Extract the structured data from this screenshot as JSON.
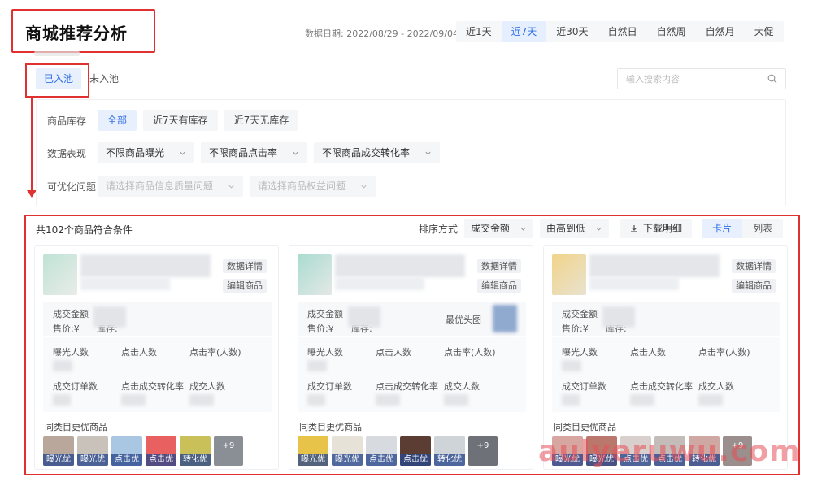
{
  "header": {
    "title": "商城推荐分析",
    "date_label": "数据日期: 2022/08/29 - 2022/09/04",
    "ranges": [
      "近1天",
      "近7天",
      "近30天",
      "自然日",
      "自然周",
      "自然月",
      "大促"
    ],
    "active_range": "近7天"
  },
  "pool_tabs": [
    "已入池",
    "未入池"
  ],
  "search": {
    "placeholder": "输入搜索内容"
  },
  "filters": {
    "stock": {
      "label": "商品库存",
      "options": [
        "全部",
        "近7天有库存",
        "近7天无库存"
      ]
    },
    "performance": {
      "label": "数据表现",
      "dropdowns": [
        "不限商品曝光",
        "不限商品点击率",
        "不限商品成交转化率"
      ]
    },
    "optimizable": {
      "label": "可优化问题",
      "dropdowns": [
        "请选择商品信息质量问题",
        "请选择商品权益问题"
      ]
    }
  },
  "results": {
    "count_text": "共102个商品符合条件",
    "sort_label": "排序方式",
    "sort_field": "成交金额",
    "sort_order": "由高到低",
    "download_label": "下载明细",
    "views": [
      "卡片",
      "列表"
    ]
  },
  "card_labels": {
    "detail_btn": "数据详情",
    "edit_btn": "编辑商品",
    "deal_amount": "成交金额",
    "price": "售价:¥",
    "stock": "库存:",
    "best_image": "最优头图",
    "metrics": [
      "曝光人数",
      "点击人数",
      "点击率(人数)",
      "成交订单数",
      "点击成交转化率",
      "成交人数"
    ],
    "similar_title": "同类目更优商品"
  },
  "cards": [
    {
      "tags": [
        "曝光优",
        "曝光优",
        "点击优",
        "点击优",
        "转化优"
      ],
      "more": "+9"
    },
    {
      "tags": [
        "曝光优",
        "曝光优",
        "点击优",
        "点击优",
        "转化优"
      ],
      "more": "+9"
    },
    {
      "tags": [
        "曝光优",
        "曝光优",
        "点击优",
        "点击优",
        "转化优"
      ],
      "more": "+9"
    }
  ],
  "watermark": "aulyeruwu.com",
  "colors": {
    "accent": "#2f6fe4",
    "highlight": "#e03030"
  }
}
